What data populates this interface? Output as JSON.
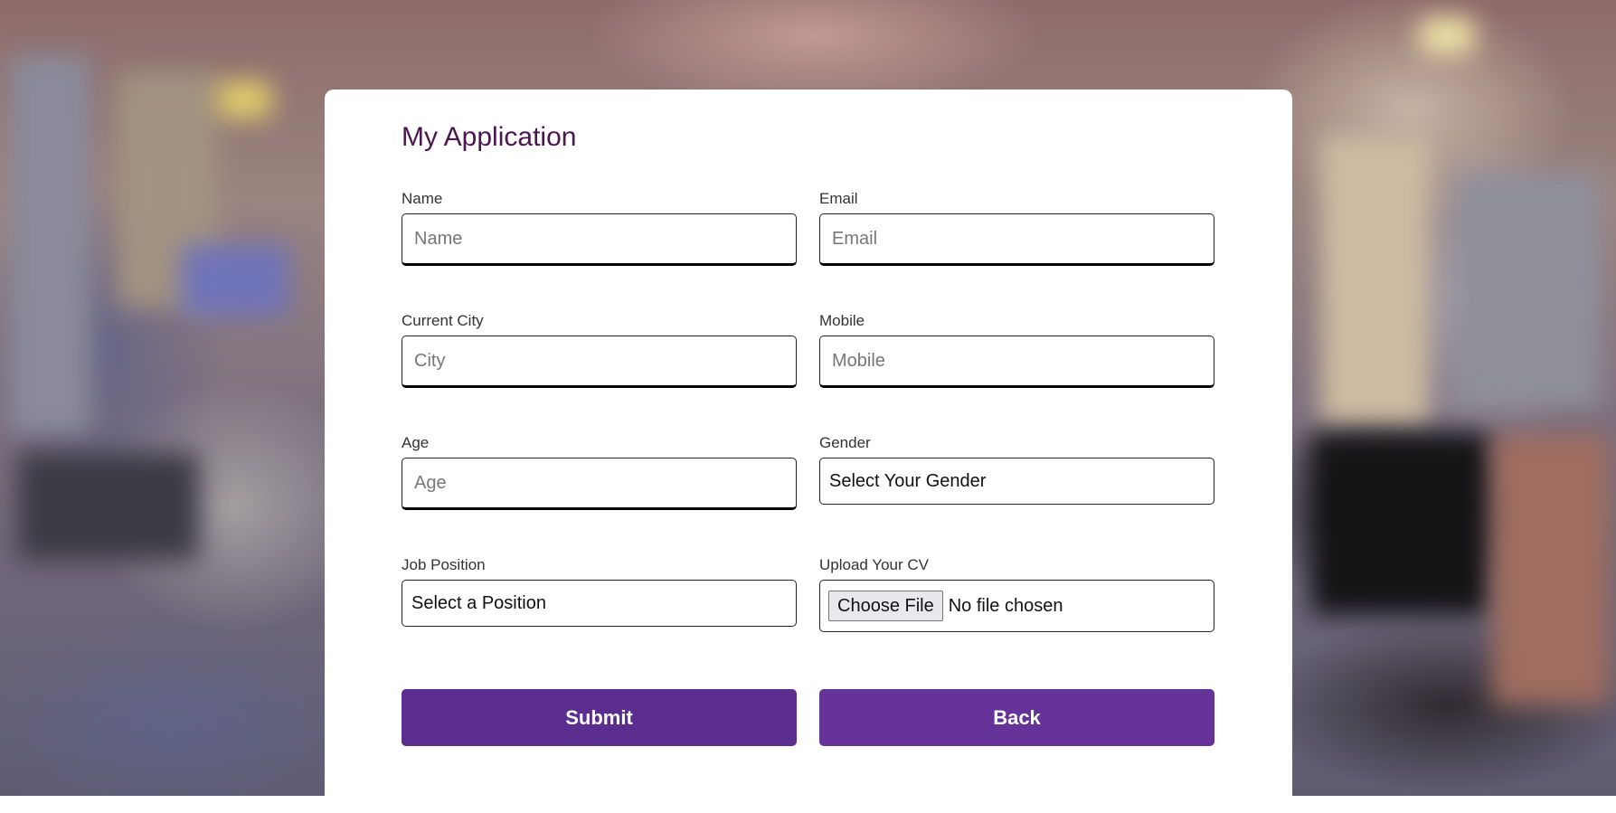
{
  "form": {
    "title": "My Application",
    "fields": {
      "name": {
        "label": "Name",
        "placeholder": "Name",
        "value": ""
      },
      "email": {
        "label": "Email",
        "placeholder": "Email",
        "value": ""
      },
      "city": {
        "label": "Current City",
        "placeholder": "City",
        "value": ""
      },
      "mobile": {
        "label": "Mobile",
        "placeholder": "Mobile",
        "value": ""
      },
      "age": {
        "label": "Age",
        "placeholder": "Age",
        "value": ""
      },
      "gender": {
        "label": "Gender",
        "selected": "Select Your Gender"
      },
      "position": {
        "label": "Job Position",
        "selected": "Select a Position"
      },
      "cv": {
        "label": "Upload Your CV",
        "button_label": "Choose File",
        "status": "No file chosen"
      }
    },
    "buttons": {
      "submit": {
        "label": "Submit",
        "color": "#5b2d8e"
      },
      "back": {
        "label": "Back",
        "color": "#663399"
      }
    }
  },
  "colors": {
    "title": "#4a1550",
    "card": "#ffffff"
  }
}
